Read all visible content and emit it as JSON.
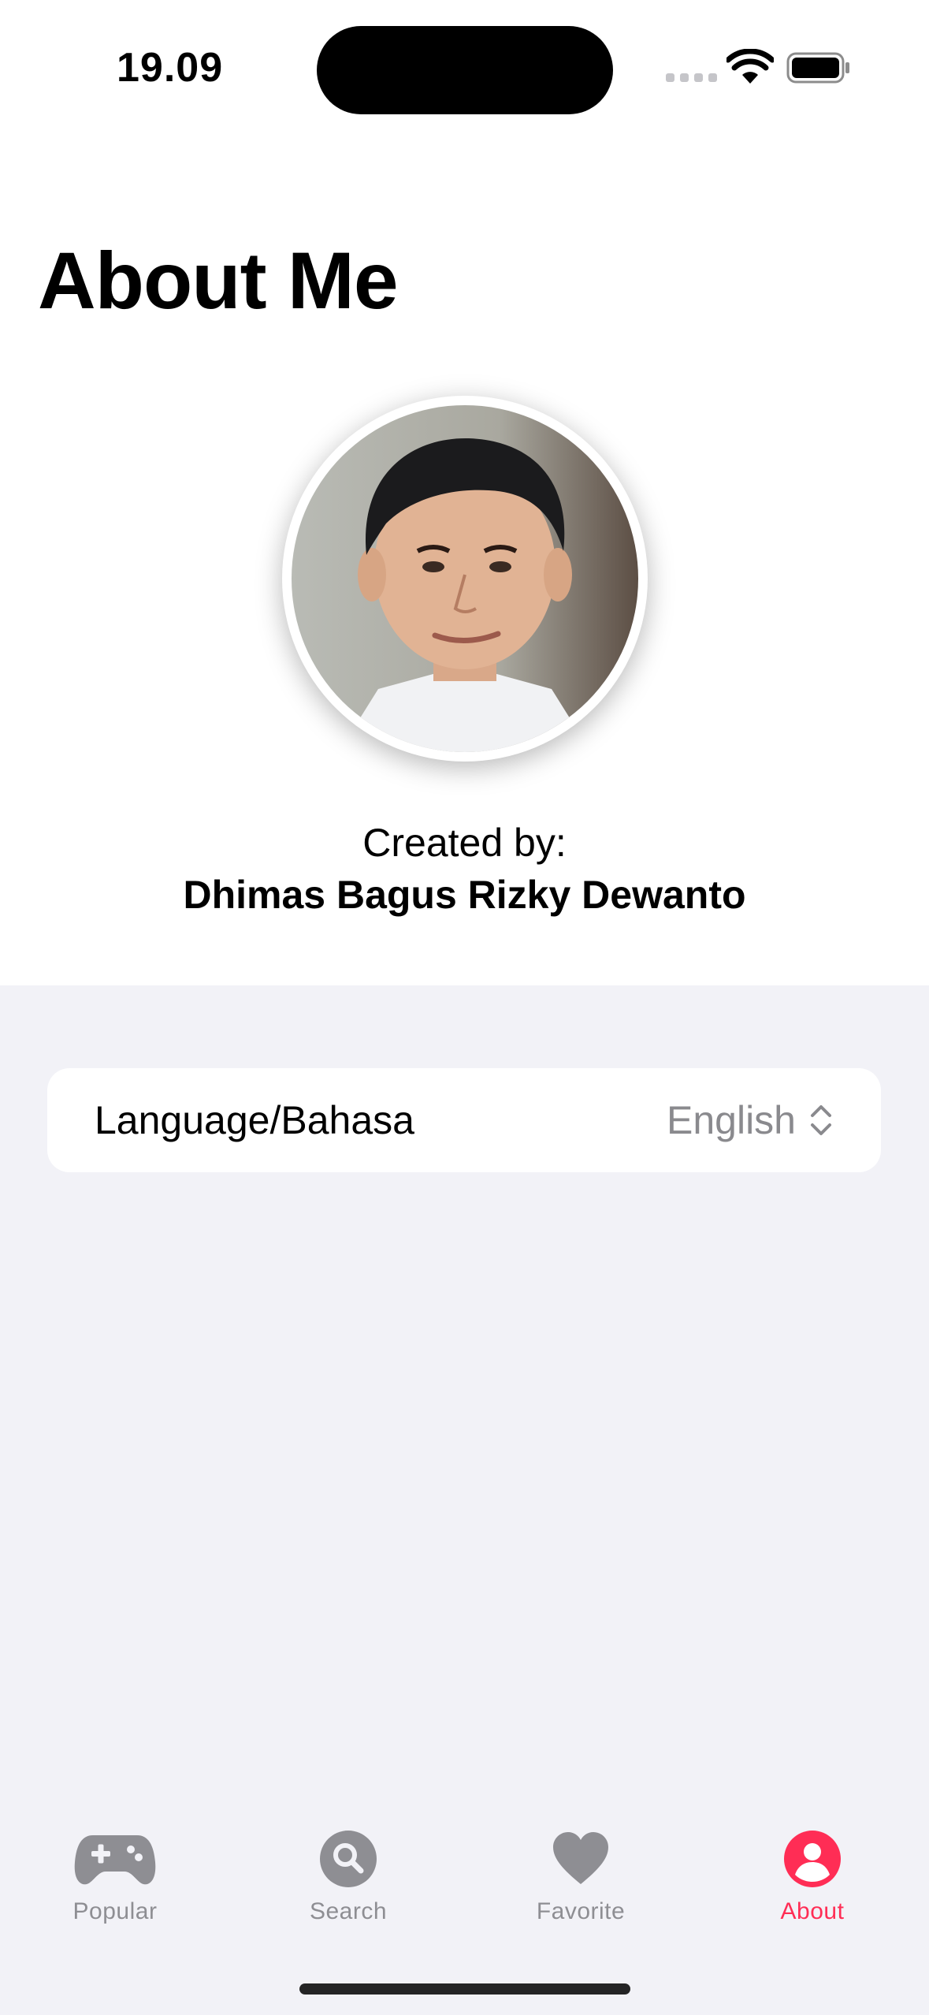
{
  "status_bar": {
    "time": "19.09"
  },
  "page": {
    "title": "About Me"
  },
  "profile": {
    "created_label": "Created by:",
    "name": "Dhimas Bagus Rizky Dewanto",
    "photo_icon": "profile-photo"
  },
  "settings": {
    "language_label": "Language/Bahasa",
    "language_value": "English"
  },
  "tabbar": {
    "active_color": "#ff2d55",
    "inactive_color": "#8e8e93",
    "tabs": [
      {
        "label": "Popular",
        "icon": "gamecontroller-icon"
      },
      {
        "label": "Search",
        "icon": "search-icon"
      },
      {
        "label": "Favorite",
        "icon": "heart-icon"
      },
      {
        "label": "About",
        "icon": "person-icon",
        "active": true
      }
    ]
  }
}
